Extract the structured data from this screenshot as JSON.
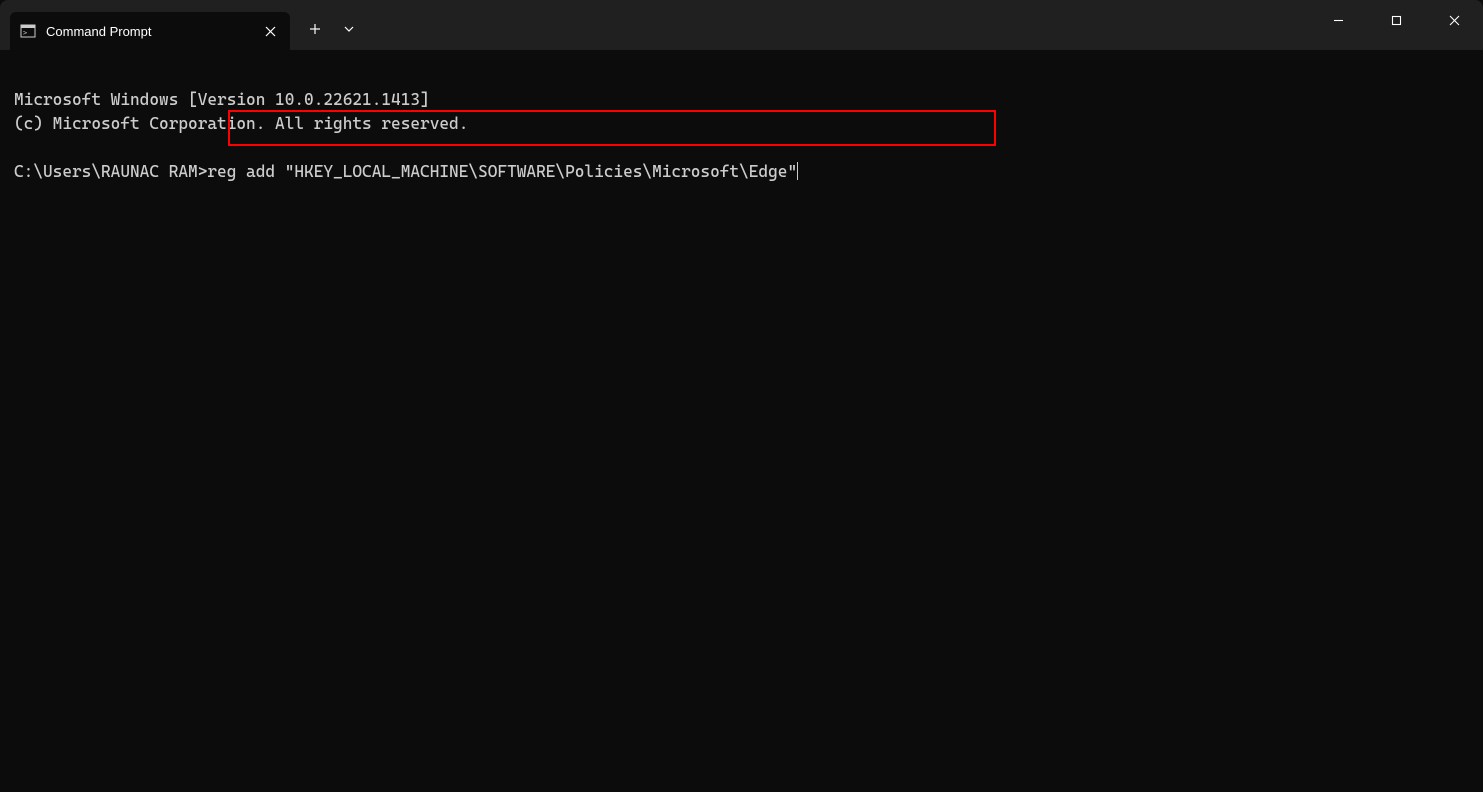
{
  "window": {
    "tab_title": "Command Prompt"
  },
  "terminal": {
    "line1": "Microsoft Windows [Version 10.0.22621.1413]",
    "line2": "(c) Microsoft Corporation. All rights reserved.",
    "prompt": "C:\\Users\\RAUNAC RAM>",
    "command": "reg add \"HKEY_LOCAL_MACHINE\\SOFTWARE\\Policies\\Microsoft\\Edge\""
  }
}
